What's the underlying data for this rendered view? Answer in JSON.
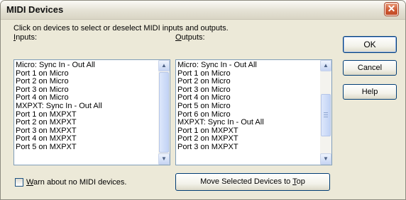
{
  "window": {
    "title": "MIDI Devices",
    "close_glyph": "✕"
  },
  "instructions": "Click on devices to select or deselect MIDI inputs and outputs.",
  "inputs": {
    "label_mnemonic": "I",
    "label_rest": "nputs:",
    "items": [
      "Micro: Sync In - Out All",
      "Port 1 on Micro",
      "Port 2 on Micro",
      "Port 3 on Micro",
      "Port 4 on Micro",
      "MXPXT: Sync In - Out All",
      "Port 1 on MXPXT",
      "Port 2 on MXPXT",
      "Port 3 on MXPXT",
      "Port 4 on MXPXT",
      "Port 5 on MXPXT"
    ]
  },
  "outputs": {
    "label_mnemonic": "O",
    "label_rest": "utputs:",
    "items": [
      "Micro: Sync In - Out All",
      "Port 1 on Micro",
      "Port 2 on Micro",
      "Port 3 on Micro",
      "Port 4 on Micro",
      "Port 5 on Micro",
      "Port 6 on Micro",
      "MXPXT: Sync In - Out All",
      "Port 1 on MXPXT",
      "Port 2 on MXPXT",
      "Port 3 on MXPXT"
    ]
  },
  "warn_checkbox": {
    "mnemonic": "W",
    "label_rest": "arn about no MIDI devices.",
    "checked": false
  },
  "move_button": {
    "label_before": "Move Selected Devices to ",
    "mnemonic": "T",
    "label_after": "op"
  },
  "buttons": {
    "ok": "OK",
    "cancel": "Cancel",
    "help": "Help"
  },
  "icons": {
    "scroll_up": "up-arrow-icon",
    "scroll_down": "down-arrow-icon",
    "close": "close-icon"
  }
}
